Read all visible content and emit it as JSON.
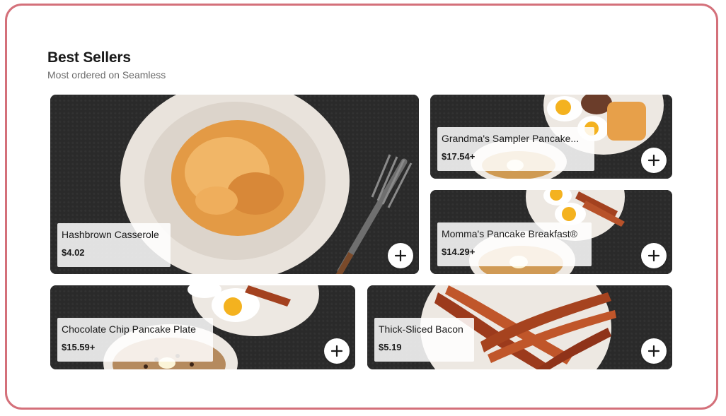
{
  "section": {
    "title": "Best Sellers",
    "subtitle": "Most ordered on Seamless"
  },
  "items": [
    {
      "name": "Hashbrown Casserole",
      "price": "$4.02",
      "add_icon": "plus-icon"
    },
    {
      "name": "Grandma's Sampler Pancake...",
      "price": "$17.54+",
      "add_icon": "plus-icon"
    },
    {
      "name": "Momma's Pancake Breakfast®",
      "price": "$14.29+",
      "add_icon": "plus-icon"
    },
    {
      "name": "Chocolate Chip Pancake Plate",
      "price": "$15.59+",
      "add_icon": "plus-icon"
    },
    {
      "name": "Thick-Sliced Bacon",
      "price": "$5.19",
      "add_icon": "plus-icon"
    }
  ],
  "colors": {
    "frame_border": "#d4707a",
    "text": "#1a1a1a",
    "muted": "#6b6b6b"
  }
}
